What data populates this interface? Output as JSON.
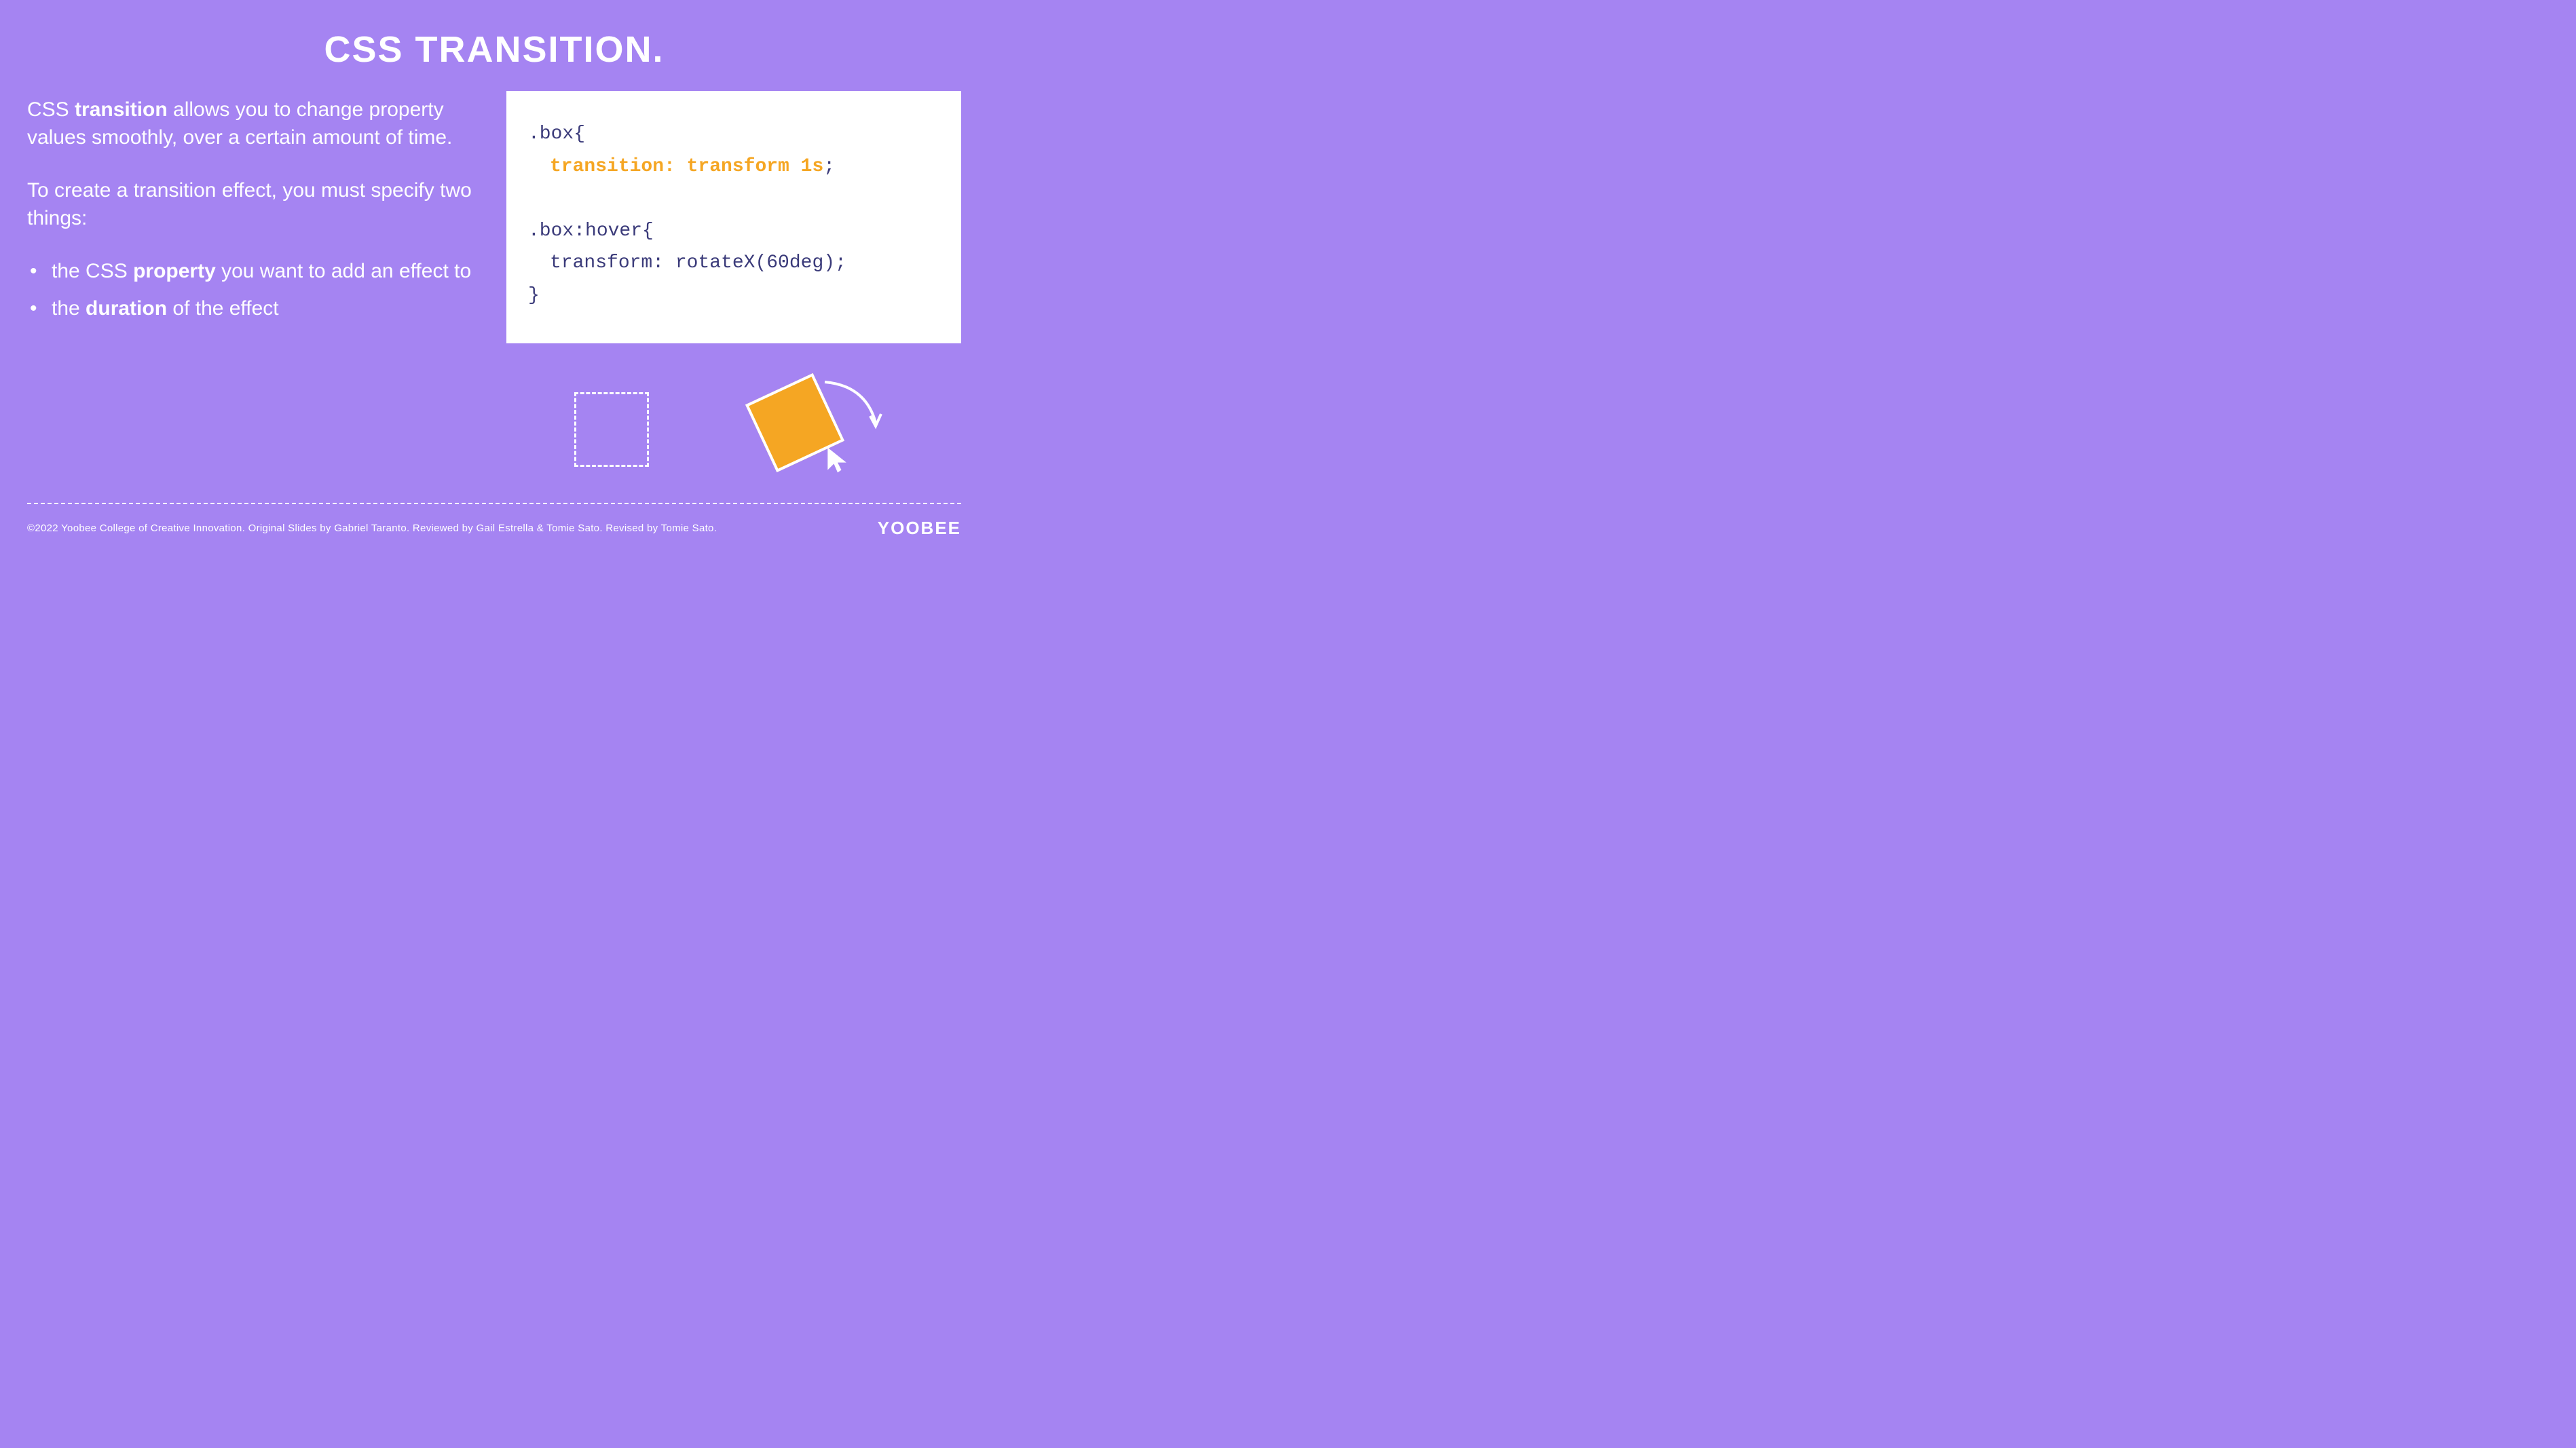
{
  "title": "CSS TRANSITION.",
  "para1_pre": "CSS ",
  "para1_bold": "transition",
  "para1_post": " allows you to change property values smoothly, over a certain amount of time.",
  "para2": "To create a transition effect, you must specify two things:",
  "bullet1_pre": "the CSS ",
  "bullet1_bold": "property",
  "bullet1_post": " you want to add an effect to",
  "bullet2_pre": "the ",
  "bullet2_bold": "duration",
  "bullet2_post": " of the effect",
  "code": {
    "l1": ".box{",
    "l2": "transition: transform 1s",
    "l2_semi": ";",
    "l3": ".box:hover{",
    "l4": "transform: rotateX(60deg);",
    "l5": "}"
  },
  "footer": "©2022 Yoobee College of Creative Innovation.  Original Slides by Gabriel Taranto.  Reviewed by Gail Estrella & Tomie Sato.  Revised by Tomie Sato.",
  "logo": "YOOBEE"
}
